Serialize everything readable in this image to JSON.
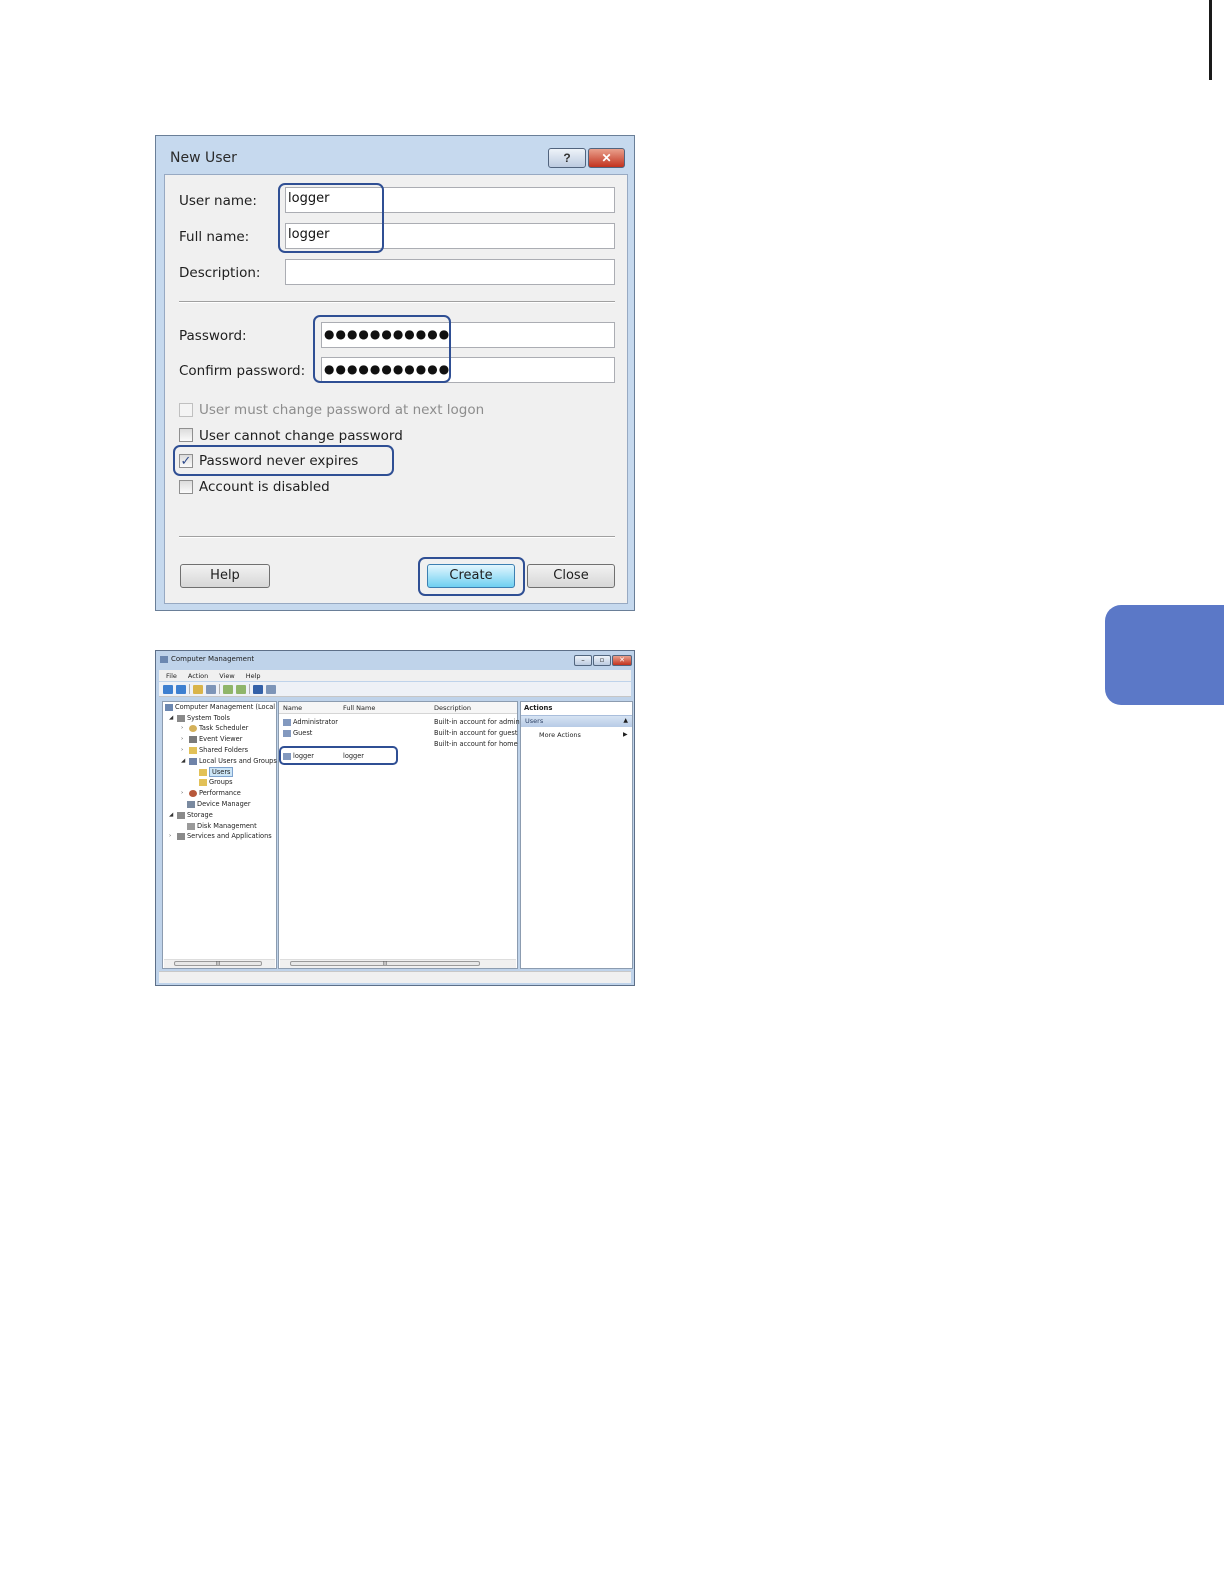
{
  "new_user_dialog": {
    "title": "New User",
    "help_glyph": "?",
    "close_glyph": "✕",
    "user_name_label": "User name:",
    "user_name_value": "logger",
    "full_name_label": "Full name:",
    "full_name_value": "logger",
    "description_label": "Description:",
    "description_value": "",
    "password_label": "Password:",
    "password_value": "●●●●●●●●●●●",
    "confirm_password_label": "Confirm password:",
    "confirm_password_value": "●●●●●●●●●●●",
    "checkboxes": [
      {
        "label": "User must change password at next logon",
        "checked": false,
        "enabled": false
      },
      {
        "label": "User cannot change password",
        "checked": false,
        "enabled": true
      },
      {
        "label": "Password never expires",
        "checked": true,
        "enabled": true
      },
      {
        "label": "Account is disabled",
        "checked": false,
        "enabled": true
      }
    ],
    "check_mark": "✓",
    "help_button": "Help",
    "create_button": "Create",
    "close_button": "Close"
  },
  "computer_management": {
    "title": "Computer Management",
    "window_controls": [
      "–",
      "▫",
      "✕"
    ],
    "menu": [
      "File",
      "Action",
      "View",
      "Help"
    ],
    "tree": [
      {
        "label": "Computer Management (Local",
        "icon": "computer-icon"
      },
      {
        "label": "System Tools",
        "icon": "tools-icon"
      },
      {
        "label": "Task Scheduler",
        "icon": "clock-icon"
      },
      {
        "label": "Event Viewer",
        "icon": "event-viewer-icon"
      },
      {
        "label": "Shared Folders",
        "icon": "folder-icon"
      },
      {
        "label": "Local Users and Groups",
        "icon": "users-icon"
      },
      {
        "label": "Users",
        "icon": "folder-icon"
      },
      {
        "label": "Groups",
        "icon": "folder-icon"
      },
      {
        "label": "Performance",
        "icon": "performance-icon"
      },
      {
        "label": "Device Manager",
        "icon": "device-icon"
      },
      {
        "label": "Storage",
        "icon": "storage-icon"
      },
      {
        "label": "Disk Management",
        "icon": "disk-icon"
      },
      {
        "label": "Services and Applications",
        "icon": "services-icon"
      }
    ],
    "columns": [
      "Name",
      "Full Name",
      "Description"
    ],
    "rows": [
      {
        "name": "Administrator",
        "full_name": "",
        "description": "Built-in account for admin"
      },
      {
        "name": "Guest",
        "full_name": "",
        "description": "Built-in account for guest"
      },
      {
        "name": "",
        "full_name": "",
        "description": "Built-in account for home"
      },
      {
        "name": "logger",
        "full_name": "logger",
        "description": ""
      }
    ],
    "actions_header": "Actions",
    "actions_section": "Users",
    "more_actions": "More Actions",
    "scroll_marker": "III"
  },
  "accent_colors": {
    "highlight": "#2f4f94",
    "side_tab": "#5b78c7"
  }
}
